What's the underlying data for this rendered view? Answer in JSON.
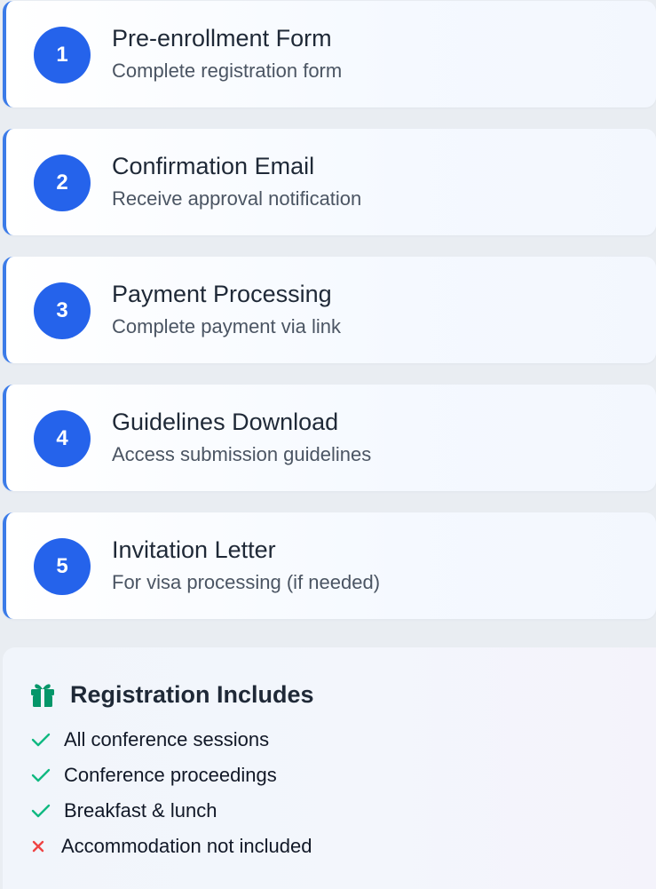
{
  "steps": [
    {
      "number": "1",
      "title": "Pre-enrollment Form",
      "description": "Complete registration form"
    },
    {
      "number": "2",
      "title": "Confirmation Email",
      "description": "Receive approval notification"
    },
    {
      "number": "3",
      "title": "Payment Processing",
      "description": "Complete payment via link"
    },
    {
      "number": "4",
      "title": "Guidelines Download",
      "description": "Access submission guidelines"
    },
    {
      "number": "5",
      "title": "Invitation Letter",
      "description": "For visa processing (if needed)"
    }
  ],
  "includes": {
    "icon": "gift-icon",
    "title": "Registration Includes",
    "items": [
      {
        "text": "All conference sessions",
        "status": "included",
        "icon": "check-icon"
      },
      {
        "text": "Conference proceedings",
        "status": "included",
        "icon": "check-icon"
      },
      {
        "text": "Breakfast & lunch",
        "status": "included",
        "icon": "check-icon"
      },
      {
        "text": "Accommodation not included",
        "status": "excluded",
        "icon": "x-icon"
      }
    ]
  },
  "colors": {
    "accent": "#2563eb",
    "step_border": "#3b7be8",
    "gift": "#059669",
    "check": "#10b981",
    "cross": "#ef4444"
  }
}
